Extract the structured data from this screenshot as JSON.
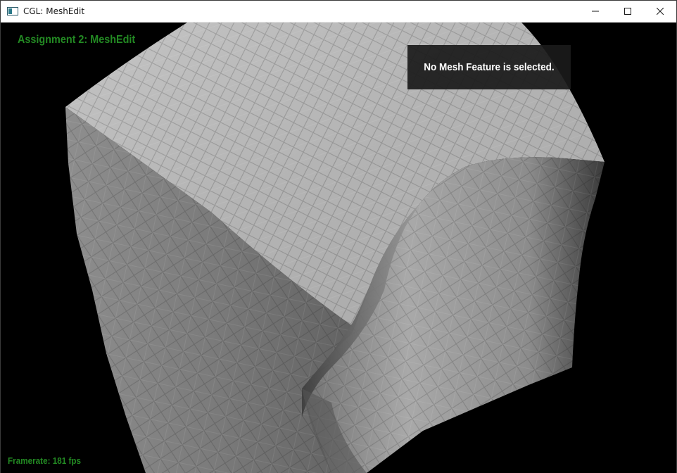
{
  "window": {
    "title": "CGL: MeshEdit",
    "controls": {
      "minimize_icon": "minimize-icon",
      "maximize_icon": "maximize-icon",
      "close_icon": "close-icon"
    }
  },
  "hud": {
    "title": "Assignment 2: MeshEdit",
    "info_panel": "No Mesh Feature is selected.",
    "framerate": "Framerate: 181 fps"
  },
  "colors": {
    "hud_green": "#238a23",
    "background": "#000000",
    "panel": "#1a1a1a",
    "mesh_light": "#c8c8c8",
    "mesh_mid": "#9a9a9a",
    "mesh_dark": "#4a4a4a"
  }
}
